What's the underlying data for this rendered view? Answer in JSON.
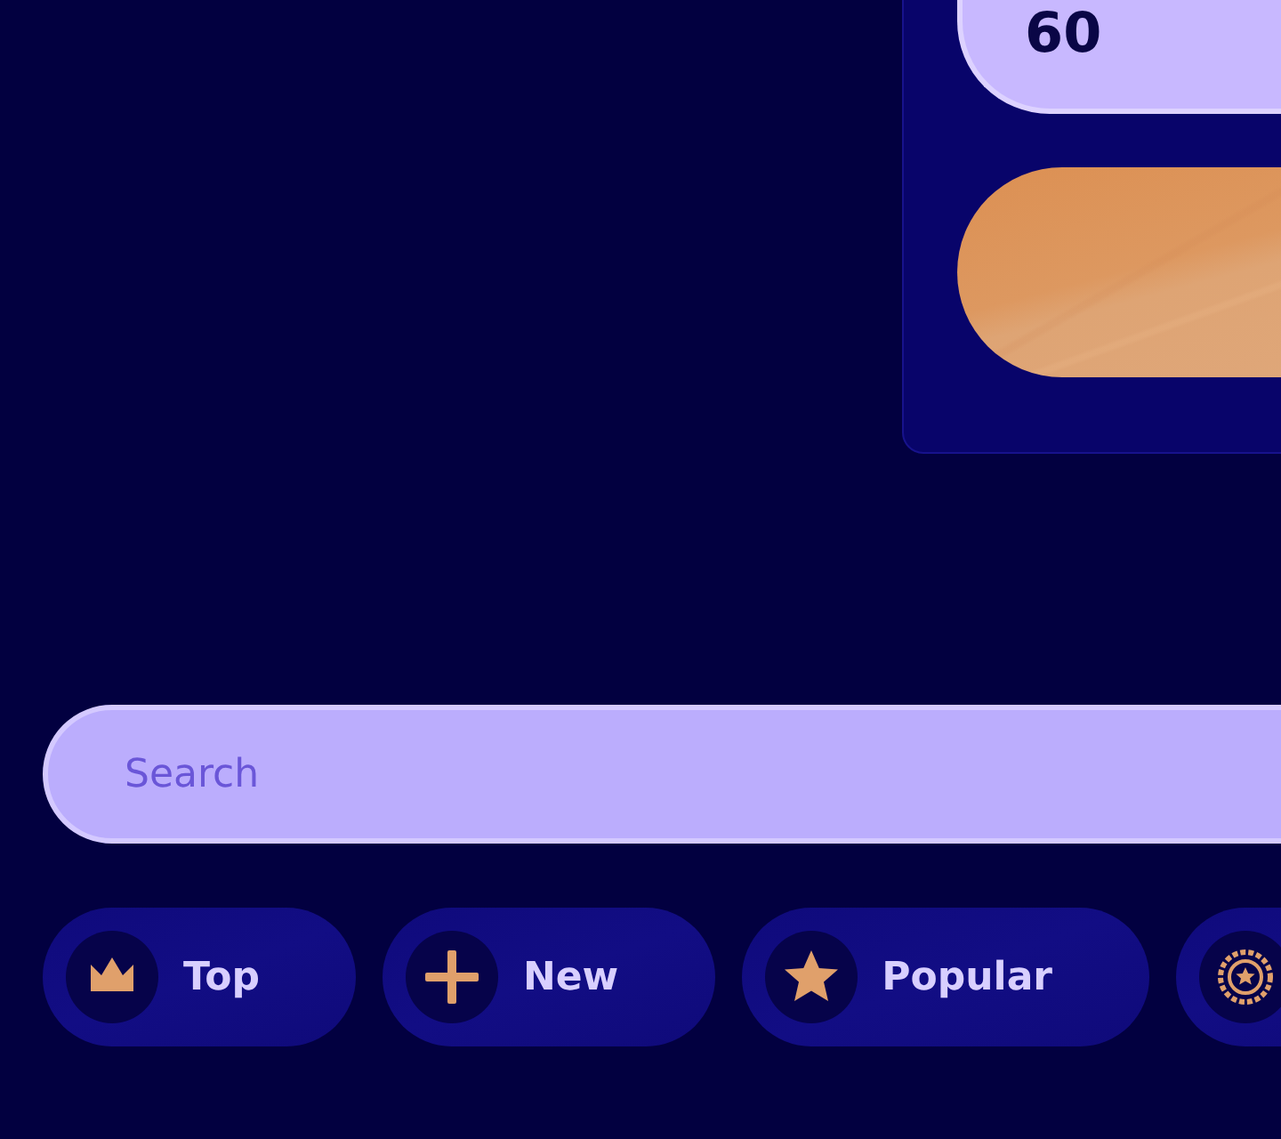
{
  "panel": {
    "value": "60"
  },
  "search": {
    "placeholder": "Search"
  },
  "chips": [
    {
      "kind": "crown",
      "label": "Top"
    },
    {
      "kind": "plus",
      "label": "New"
    },
    {
      "kind": "star",
      "label": "Popular"
    },
    {
      "kind": "badge"
    }
  ]
}
